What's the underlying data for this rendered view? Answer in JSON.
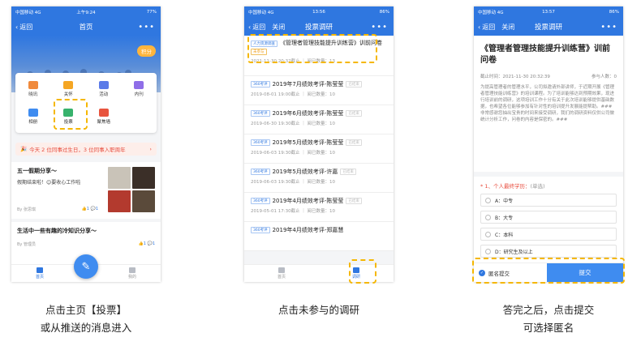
{
  "phone1": {
    "status": {
      "carrier": "中国移动 4G",
      "time": "上午9:24",
      "battery": "77%"
    },
    "nav": {
      "back": "返回",
      "title": "首页",
      "more": "•••"
    },
    "banner": {
      "score": "积分"
    },
    "grid": [
      {
        "label": "晓讯",
        "color": "#f08a3c"
      },
      {
        "label": "关怀",
        "color": "#f5a623"
      },
      {
        "label": "活动",
        "color": "#5b7be8"
      },
      {
        "label": "内刊",
        "color": "#8f6ee8"
      },
      {
        "label": "相册",
        "color": "#3f8cf0"
      },
      {
        "label": "投票",
        "color": "#37b26c"
      },
      {
        "label": "聚焦墙",
        "color": "#e8543e"
      }
    ],
    "notice": {
      "text": "今天 2 位同事过生日，3 位同事入职周年",
      "arrow": "›"
    },
    "posts": [
      {
        "title": "五一假期分享～",
        "body": "假期结束啦！😊要收心工作啦",
        "author": "By 张思琪",
        "likes": "1",
        "comments": "1"
      },
      {
        "title": "生活中一些有趣的冷知识分享～",
        "author": "By 管理员",
        "likes": "1",
        "comments": "1"
      }
    ],
    "tabs": {
      "home": "首页",
      "mine": "我的"
    }
  },
  "phone2": {
    "status": {
      "carrier": "中国移动 4G",
      "time": "13:56",
      "battery": "86%"
    },
    "nav": {
      "back": "返回",
      "close": "关闭",
      "title": "投票调研",
      "more": "•••"
    },
    "first": {
      "tag": "人力资源调查",
      "title": "《管理者管理技能提升训练营》训前问卷",
      "badge": "未参与",
      "sub": "2021-11-30 20:32截止 ｜ 阅已数量：13"
    },
    "items": [
      {
        "tag": "360考评",
        "title": "2019年7月绩效考评-陈莹莹",
        "badge": "已结束",
        "sub": "2019-08-01 19:00截止 ｜ 阅已数量：10"
      },
      {
        "tag": "360考评",
        "title": "2019年6月绩效考评-陈莹莹",
        "badge": "已结束",
        "sub": "2019-06-30 19:30截止 ｜ 阅已数量：10"
      },
      {
        "tag": "360考评",
        "title": "2019年5月绩效考评-陈莹莹",
        "badge": "已结束",
        "sub": "2019-06-03 19:30截止 ｜ 阅已数量：10"
      },
      {
        "tag": "360考评",
        "title": "2019年5月绩效考评-许嘉",
        "badge": "已结束",
        "sub": "2019-06-03 19:30截止 ｜ 阅已数量：10"
      },
      {
        "tag": "360考评",
        "title": "2019年4月绩效考评-陈莹莹",
        "badge": "已结束",
        "sub": "2019-05-01 17:30截止 ｜ 阅已数量：10"
      },
      {
        "tag": "360考评",
        "title": "2019年4月绩效考评-郑嘉慧",
        "badge": "",
        "sub": ""
      }
    ],
    "tabs": {
      "left": "首页",
      "right": "调研"
    }
  },
  "phone3": {
    "status": {
      "carrier": "中国移动 4G",
      "time": "13:57",
      "battery": "86%"
    },
    "nav": {
      "back": "返回",
      "close": "关闭",
      "title": "投票调研",
      "more": "•••"
    },
    "title": "《管理者管理技能提升训练营》训前问卷",
    "deadline": "截止时间：2021-11-30 20:32:39",
    "participants": "参与人数：0",
    "desc": "为提高管理者的管理水平，公司拟邀请外部讲师，于近期开展《管理者管理技能训练营》的培训课程。为了培训能够达到预期效果，现进行培训前的调研，这项培训工作十分有关于此次培训能够提供基础数据，也希望各位能够参加有针对性的培训提升发展能提帮助。### 非常感谢您抽出宝贵的时间来接受调研，我们的调研资料仅供公司做统计分析工作，问卷的内容是保密的。###",
    "question": {
      "num": "* 1、个人最终学历：",
      "hint": "(单选)"
    },
    "options": [
      {
        "label": "A：中专"
      },
      {
        "label": "B：大专"
      },
      {
        "label": "C：本科"
      },
      {
        "label": "D：研究生及以上"
      }
    ],
    "anon": "匿名提交",
    "submit": "提交"
  },
  "captions": {
    "c1a": "点击主页【投票】",
    "c1b": "或从推送的消息进入",
    "c2": "点击未参与的调研",
    "c3a": "答完之后，点击提交",
    "c3b": "可选择匿名"
  }
}
